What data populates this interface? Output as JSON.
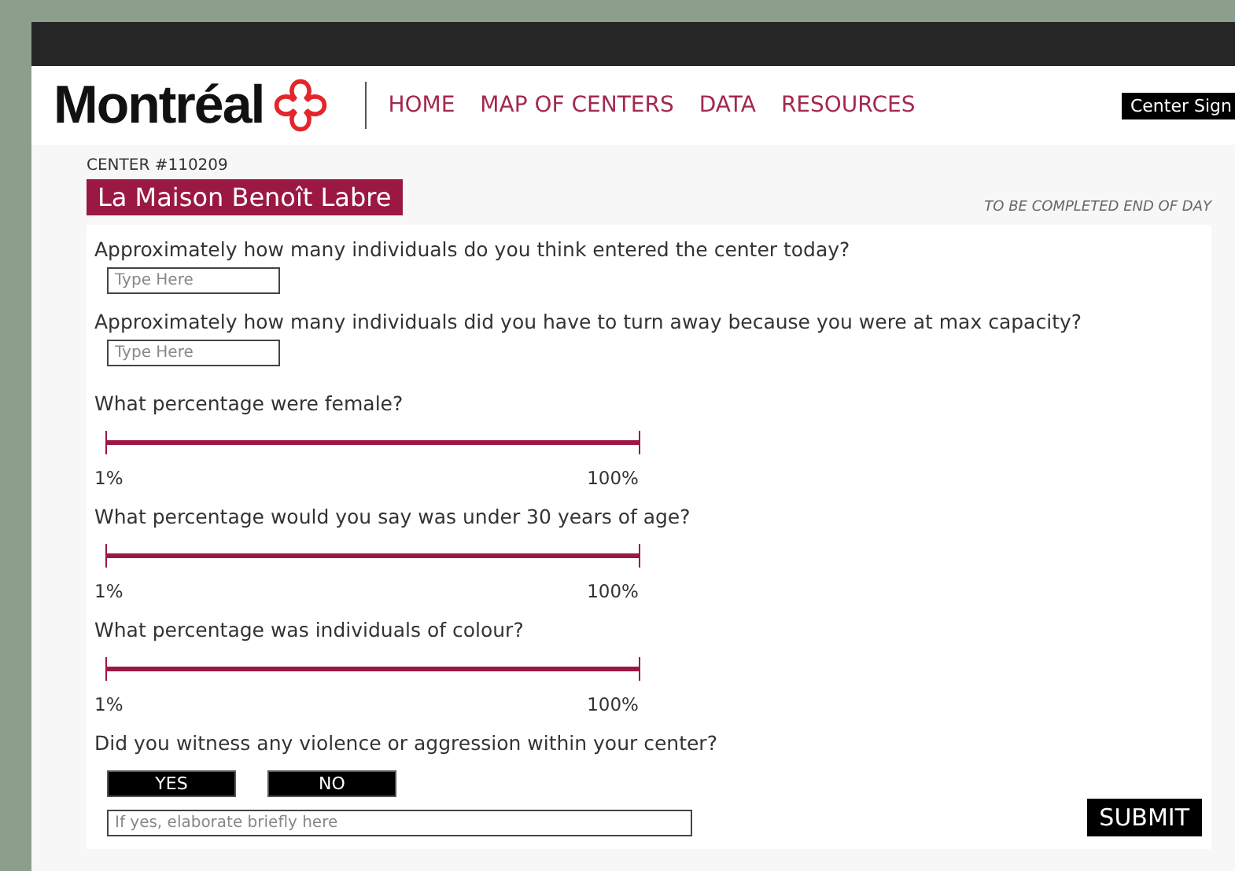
{
  "header": {
    "logo": "Montréal",
    "nav": [
      "HOME",
      "MAP OF CENTERS",
      "DATA",
      "RESOURCES"
    ],
    "account_button": "Center Sign"
  },
  "center": {
    "number": "CENTER #110209",
    "name": "La Maison Benoît Labre",
    "note": "TO BE COMPLETED END OF DAY"
  },
  "questions": [
    {
      "kind": "text",
      "label": "Approximately how many individuals do you think entered the center today?",
      "placeholder": "Type Here"
    },
    {
      "kind": "text",
      "label": "Approximately how many individuals did you have to turn away because you were at max capacity?",
      "placeholder": "Type Here"
    },
    {
      "kind": "range",
      "label": "What percentage were female?",
      "min_label": "1%",
      "max_label": "100%"
    },
    {
      "kind": "range",
      "label": "What percentage would you say was under 30 years of age?",
      "min_label": "1%",
      "max_label": "100%"
    },
    {
      "kind": "range",
      "label": "What percentage was individuals of colour?",
      "min_label": "1%",
      "max_label": "100%"
    },
    {
      "kind": "yesno",
      "label": "Did you witness any violence or aggression within your center?",
      "options": [
        "YES",
        "NO"
      ],
      "placeholder": "If yes, elaborate briefly here"
    }
  ],
  "submit_button": "SUBMIT"
}
